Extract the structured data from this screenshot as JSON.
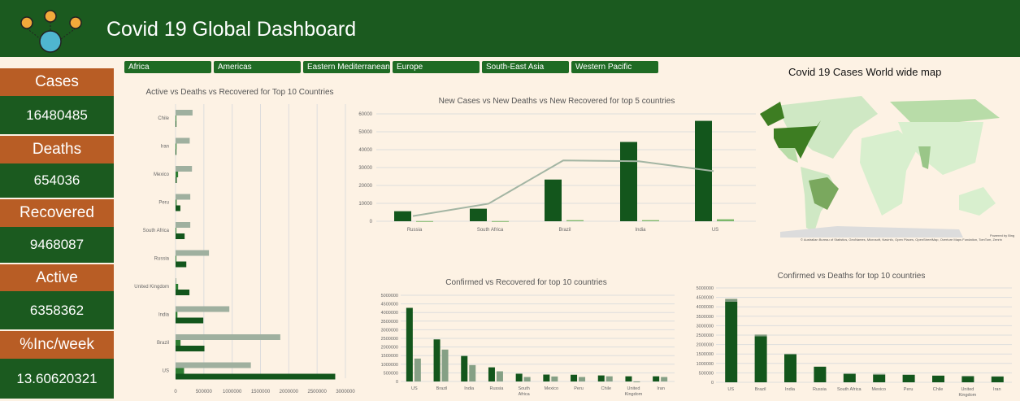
{
  "header": {
    "title": "Covid 19 Global Dashboard"
  },
  "kpis": [
    {
      "label": "Cases",
      "value": "16480485"
    },
    {
      "label": "Deaths",
      "value": "654036"
    },
    {
      "label": "Recovered",
      "value": "9468087"
    },
    {
      "label": "Active",
      "value": "6358362"
    },
    {
      "label": "%Inc/week",
      "value": "13.60620321"
    }
  ],
  "filters": [
    "Africa",
    "Americas",
    "Eastern Mediterranean",
    "Europe",
    "South-East Asia",
    "Western Pacific"
  ],
  "map": {
    "title": "Covid 19 Cases World wide map",
    "powered": "Powered by Bing",
    "attribution": "© Australian Bureau of Statistics, GeoNames, Microsoft, Navinfo, Open Places, OpenStreetMap, Overture Maps Fundation, TomTom, Zenrin"
  },
  "colors": {
    "dark": "#13561c",
    "mid": "#2e7d32",
    "gray": "#9fb09f",
    "light": "#7cb86a"
  },
  "chart_data": [
    {
      "type": "bar",
      "orientation": "horizontal",
      "title": "Active vs Deaths vs Recovered for Top 10 Countries",
      "categories": [
        "Chile",
        "Iran",
        "Mexico",
        "Peru",
        "South Africa",
        "Russia",
        "United Kingdom",
        "India",
        "Brazil",
        "US"
      ],
      "series": [
        {
          "name": "Recovered",
          "values": [
            300000,
            250000,
            290000,
            260000,
            260000,
            590000,
            1400,
            950000,
            1850000,
            1330000
          ]
        },
        {
          "name": "Deaths",
          "values": [
            9000,
            17000,
            45000,
            19000,
            8000,
            14000,
            46000,
            33000,
            88000,
            150000
          ]
        },
        {
          "name": "Active",
          "values": [
            2000,
            10000,
            20000,
            85000,
            160000,
            190000,
            245000,
            490000,
            510000,
            2820000
          ]
        }
      ],
      "xlim": [
        0,
        3000000
      ],
      "ticks": [
        "0",
        "500000",
        "1000000",
        "1500000",
        "2000000",
        "2500000",
        "3000000"
      ]
    },
    {
      "type": "bar+line",
      "title": "New Cases vs New Deaths vs New Recovered for top 5 countries",
      "categories": [
        "Russia",
        "South Africa",
        "Brazil",
        "India",
        "US"
      ],
      "series": [
        {
          "name": "New Cases",
          "values": [
            5600,
            7000,
            23300,
            44300,
            56100
          ]
        },
        {
          "name": "New Deaths",
          "values": [
            100,
            100,
            600,
            600,
            1100
          ]
        },
        {
          "name": "New Recovered",
          "kind": "line",
          "values": [
            2900,
            9800,
            34000,
            33500,
            28000
          ]
        }
      ],
      "ylim": [
        0,
        60000
      ],
      "ticks": [
        "0",
        "10000",
        "20000",
        "30000",
        "40000",
        "50000",
        "60000"
      ]
    },
    {
      "type": "bar",
      "title": "Confirmed vs Recovered for top 10 countries",
      "categories": [
        "US",
        "Brazil",
        "India",
        "Russia",
        "South Africa",
        "Mexico",
        "Peru",
        "Chile",
        "United Kingdom",
        "Iran"
      ],
      "series": [
        {
          "name": "Confirmed",
          "values": [
            4270000,
            2440000,
            1480000,
            820000,
            450000,
            400000,
            390000,
            350000,
            300000,
            300000
          ]
        },
        {
          "name": "Recovered",
          "values": [
            1330000,
            1850000,
            950000,
            590000,
            260000,
            290000,
            260000,
            300000,
            1400,
            260000
          ]
        }
      ],
      "ylim": [
        0,
        5000000
      ],
      "ticks": [
        "0",
        "500000",
        "1000000",
        "1500000",
        "2000000",
        "2500000",
        "3000000",
        "3500000",
        "4000000",
        "4500000",
        "5000000"
      ]
    },
    {
      "type": "stacked-bar",
      "title": "Confirmed vs Deaths for top 10 countries",
      "categories": [
        "US",
        "Brazil",
        "India",
        "Russia",
        "South Africa",
        "Mexico",
        "Peru",
        "Chile",
        "United Kingdom",
        "Iran"
      ],
      "series": [
        {
          "name": "Confirmed",
          "values": [
            4270000,
            2440000,
            1480000,
            820000,
            450000,
            400000,
            390000,
            350000,
            300000,
            300000
          ]
        },
        {
          "name": "Deaths",
          "values": [
            150000,
            88000,
            33000,
            14000,
            8000,
            45000,
            19000,
            9000,
            46000,
            17000
          ]
        }
      ],
      "ylim": [
        0,
        5000000
      ],
      "ticks": [
        "0",
        "500000",
        "1000000",
        "1500000",
        "2000000",
        "2500000",
        "3000000",
        "3500000",
        "4000000",
        "4500000",
        "5000000"
      ]
    }
  ]
}
